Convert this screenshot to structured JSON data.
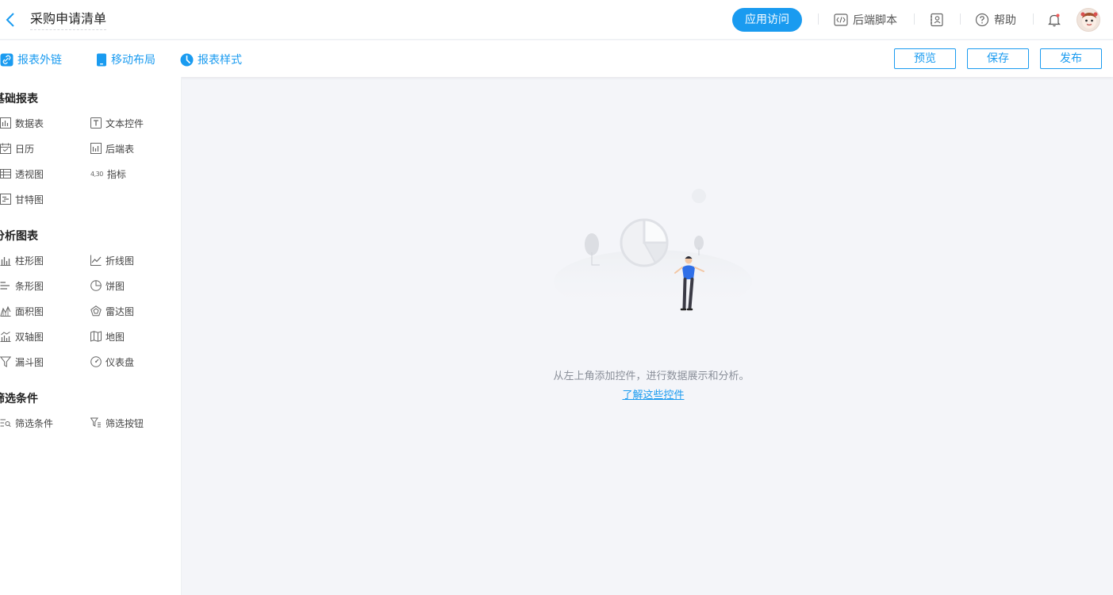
{
  "header": {
    "title": "采购申请清单",
    "access_button": "应用访问",
    "backend_script": "后端脚本",
    "help": "帮助"
  },
  "toolbar": {
    "report_link": "报表外链",
    "mobile_layout": "移动布局",
    "report_style": "报表样式",
    "preview": "预览",
    "save": "保存",
    "publish": "发布"
  },
  "sidebar": {
    "basic": {
      "title": "基础报表",
      "items": [
        "数据表",
        "文本控件",
        "日历",
        "后端表",
        "透视图",
        "指标",
        "甘特图"
      ]
    },
    "analysis": {
      "title": "分析图表",
      "items": [
        "柱形图",
        "折线图",
        "条形图",
        "饼图",
        "面积图",
        "雷达图",
        "双轴图",
        "地图",
        "漏斗图",
        "仪表盘"
      ]
    },
    "filter": {
      "title": "筛选条件",
      "items": [
        "筛选条件",
        "筛选按钮"
      ]
    },
    "metric_icon_text": "4,30"
  },
  "canvas": {
    "empty_text": "从左上角添加控件，进行数据展示和分析。",
    "learn_link": "了解这些控件"
  },
  "colors": {
    "primary": "#1a9bf0",
    "canvas_bg": "#f4f5f9",
    "figure_shirt": "#2f6fe8"
  }
}
